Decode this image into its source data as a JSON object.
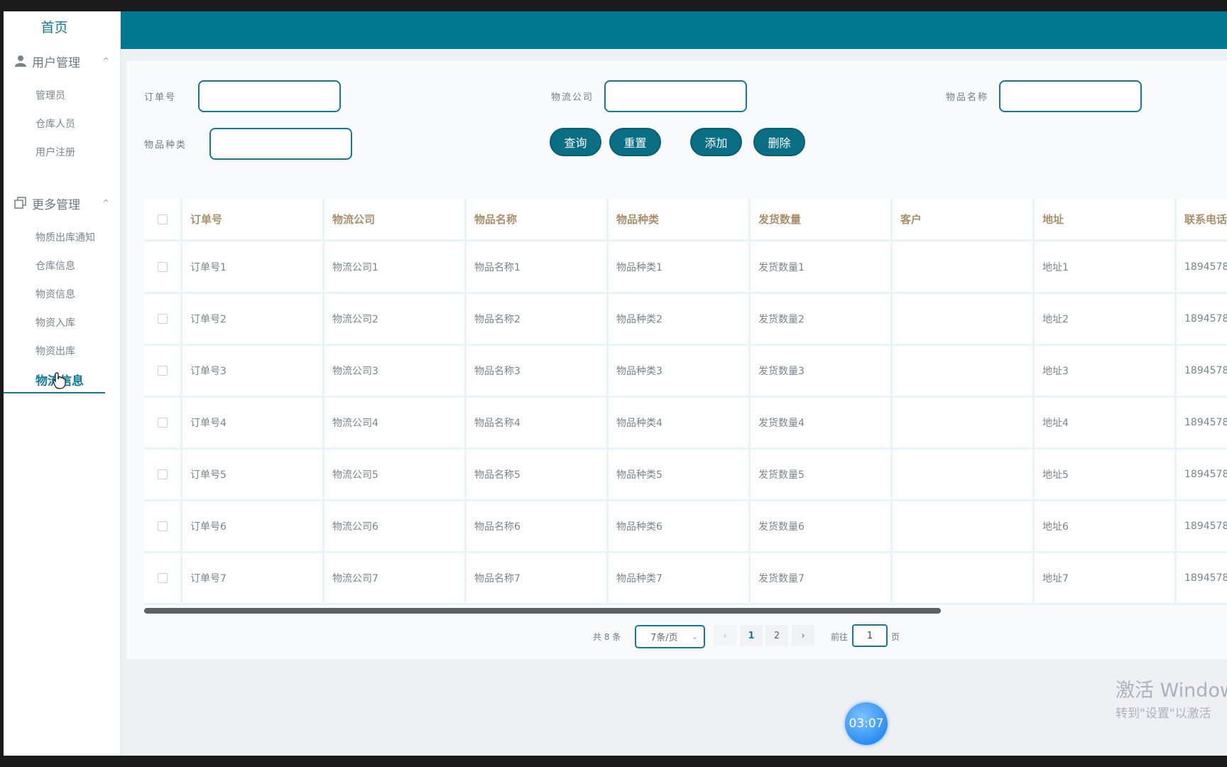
{
  "sidebar": {
    "home": "首页",
    "groups": [
      {
        "label": "用户管理",
        "items": [
          "管理员",
          "仓库人员",
          "用户注册"
        ]
      },
      {
        "label": "更多管理",
        "items": [
          "物质出库通知",
          "仓库信息",
          "物资信息",
          "物资入库",
          "物资出库",
          "物流信息"
        ]
      }
    ],
    "active_item": "物流信息",
    "chevron": "^"
  },
  "search": {
    "order_no_label": "订单号",
    "company_label": "物流公司",
    "item_name_label": "物品名称",
    "item_type_label": "物品种类",
    "order_no_value": "",
    "company_value": "",
    "item_name_value": "",
    "item_type_value": ""
  },
  "buttons": {
    "query": "查询",
    "reset": "重置",
    "add": "添加",
    "delete": "删除"
  },
  "table": {
    "columns": [
      "订单号",
      "物流公司",
      "物品名称",
      "物品种类",
      "发货数量",
      "客户",
      "地址",
      "联系电话"
    ],
    "rows": [
      [
        "订单号1",
        "物流公司1",
        "物品名称1",
        "物品种类1",
        "发货数量1",
        "",
        "地址1",
        "1894578"
      ],
      [
        "订单号2",
        "物流公司2",
        "物品名称2",
        "物品种类2",
        "发货数量2",
        "",
        "地址2",
        "1894578"
      ],
      [
        "订单号3",
        "物流公司3",
        "物品名称3",
        "物品种类3",
        "发货数量3",
        "",
        "地址3",
        "1894578"
      ],
      [
        "订单号4",
        "物流公司4",
        "物品名称4",
        "物品种类4",
        "发货数量4",
        "",
        "地址4",
        "1894578"
      ],
      [
        "订单号5",
        "物流公司5",
        "物品名称5",
        "物品种类5",
        "发货数量5",
        "",
        "地址5",
        "1894578"
      ],
      [
        "订单号6",
        "物流公司6",
        "物品名称6",
        "物品种类6",
        "发货数量6",
        "",
        "地址6",
        "1894578"
      ],
      [
        "订单号7",
        "物流公司7",
        "物品名称7",
        "物品种类7",
        "发货数量7",
        "",
        "地址7",
        "1894578"
      ]
    ]
  },
  "pagination": {
    "total_text": "共 8 条",
    "page_size": "7条/页",
    "prev": "‹",
    "pages": [
      "1",
      "2"
    ],
    "next": "›",
    "goto_prefix": "前往",
    "goto_value": "1",
    "goto_suffix": "页"
  },
  "overlay": {
    "watermark_line1": "激活 Windows",
    "watermark_line2": "转到\"设置\"以激活",
    "timer": "03:07"
  },
  "colors": {
    "accent": "#127a96",
    "header": "#00788f",
    "button": "#0a6e85",
    "header_text": "#a88f6a"
  }
}
